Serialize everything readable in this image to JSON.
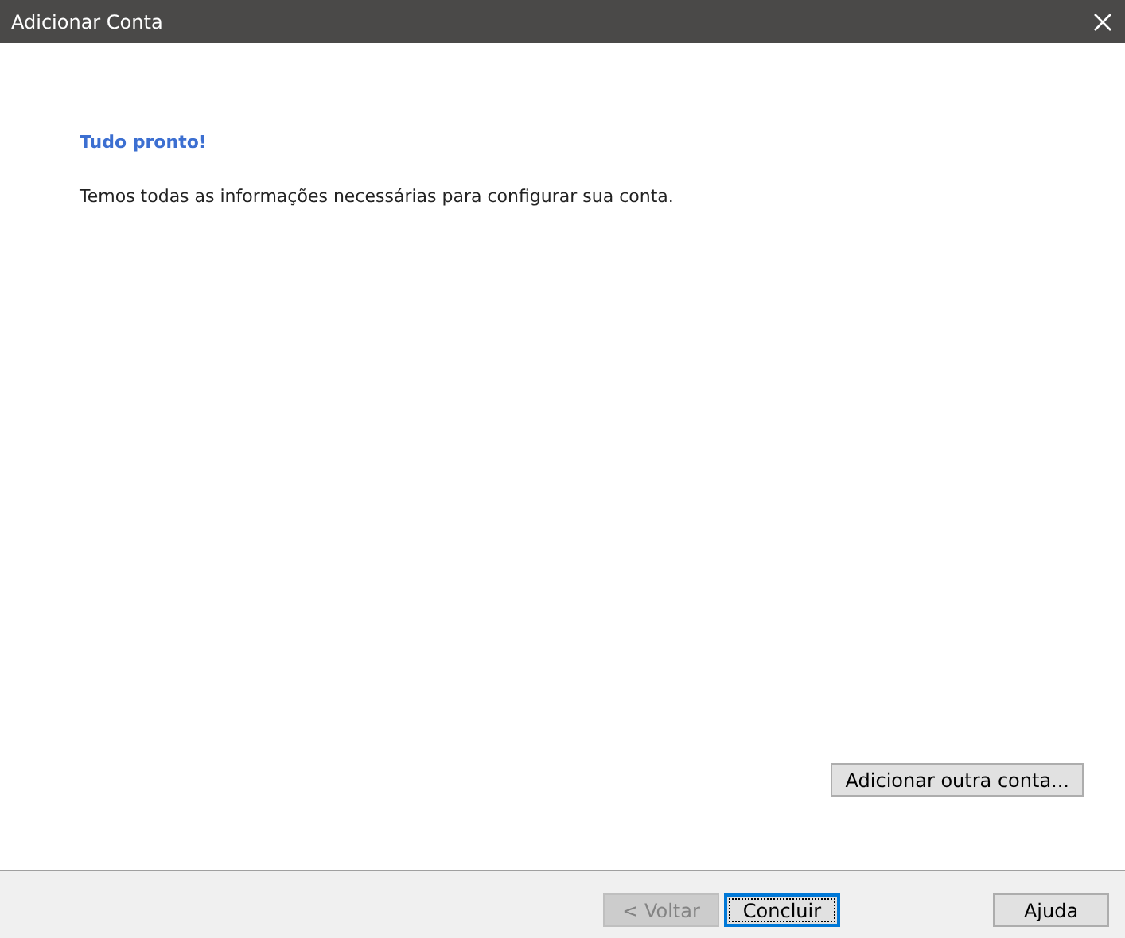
{
  "window": {
    "title": "Adicionar Conta"
  },
  "heading": "Tudo pronto!",
  "message": "Temos todas as informações necessárias para configurar sua conta.",
  "add_another_button": {
    "label": "Adicionar outra conta..."
  },
  "footer_buttons": [
    {
      "label": "< Voltar",
      "disabled": true,
      "default": false
    },
    {
      "label": "Concluir",
      "disabled": false,
      "default": true
    },
    {
      "label": "Ajuda",
      "disabled": false,
      "default": false
    }
  ]
}
